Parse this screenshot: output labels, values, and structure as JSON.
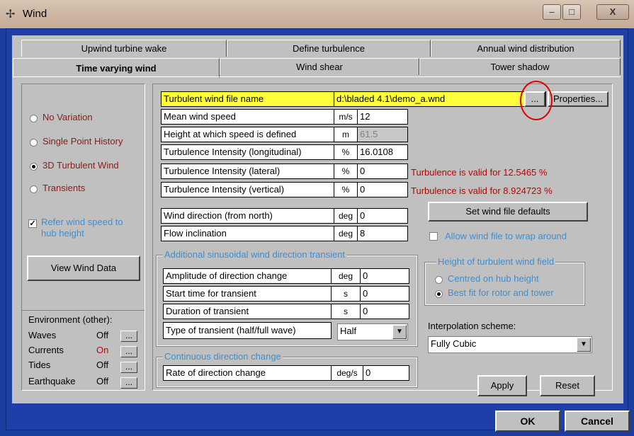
{
  "window": {
    "title": "Wind",
    "title_icon": "wind-turbine-icon"
  },
  "tabs_row1": [
    "Upwind turbine wake",
    "Define turbulence",
    "Annual wind distribution"
  ],
  "tabs_row2": [
    "Time varying wind",
    "Wind shear",
    "Tower shadow"
  ],
  "left": {
    "options": [
      "No Variation",
      "Single Point History",
      "3D Turbulent Wind",
      "Transients"
    ],
    "selected": "3D Turbulent Wind",
    "refer_label_1": "Refer wind speed to",
    "refer_label_2": "hub height",
    "refer_checked": true,
    "view_button": "View Wind Data",
    "env_title": "Environment (other):",
    "env": [
      {
        "name": "Waves",
        "status": "Off"
      },
      {
        "name": "Currents",
        "status": "On"
      },
      {
        "name": "Tides",
        "status": "Off"
      },
      {
        "name": "Earthquake",
        "status": "Off"
      }
    ],
    "env_button": "..."
  },
  "file": {
    "label": "Turbulent wind file name",
    "value": "d:\\bladed 4.1\\demo_a.wnd",
    "browse": "...",
    "properties": "Properties..."
  },
  "params": [
    {
      "label": "Mean wind speed",
      "unit": "m/s",
      "value": "12"
    },
    {
      "label": "Height at which speed is defined",
      "unit": "m",
      "value": "61.5"
    },
    {
      "label": "Turbulence Intensity (longitudinal)",
      "unit": "%",
      "value": "16.0108"
    },
    {
      "label": "Turbulence Intensity (lateral)",
      "unit": "%",
      "value": "0"
    },
    {
      "label": "Turbulence Intensity (vertical)",
      "unit": "%",
      "value": "0"
    }
  ],
  "valid": {
    "lateral": "Turbulence is valid for  12.5465 %",
    "vertical": "Turbulence is valid for  8.924723 %"
  },
  "direction": [
    {
      "label": "Wind direction (from north)",
      "unit": "deg",
      "value": "0"
    },
    {
      "label": "Flow inclination",
      "unit": "deg",
      "value": "8"
    }
  ],
  "set_defaults": "Set wind file defaults",
  "wrap": "Allow wind file to wrap around",
  "transient": {
    "title": "Additional sinusoidal wind direction transient",
    "rows": [
      {
        "label": "Amplitude of direction change",
        "unit": "deg",
        "value": "0"
      },
      {
        "label": "Start time for transient",
        "unit": "s",
        "value": "0"
      },
      {
        "label": "Duration of transient",
        "unit": "s",
        "value": "0"
      }
    ],
    "type_label": "Type of transient (half/full wave)",
    "type_value": "Half"
  },
  "height": {
    "title": "Height of turbulent wind field",
    "options": [
      "Centred on hub height",
      "Best fit for rotor and tower"
    ],
    "selected": "Best fit for rotor and tower"
  },
  "interp": {
    "label": "Interpolation scheme:",
    "value": "Fully Cubic"
  },
  "continuous": {
    "title": "Continuous direction change",
    "label": "Rate of direction change",
    "unit": "deg/s",
    "value": "0"
  },
  "buttons": {
    "apply": "Apply",
    "reset": "Reset",
    "ok": "OK",
    "cancel": "Cancel"
  },
  "colors": {
    "highlight": "#ffff3c",
    "accent_blue": "#3a8fd6",
    "valid_red": "#c00000",
    "frame_blue": "#1e3fa8"
  }
}
